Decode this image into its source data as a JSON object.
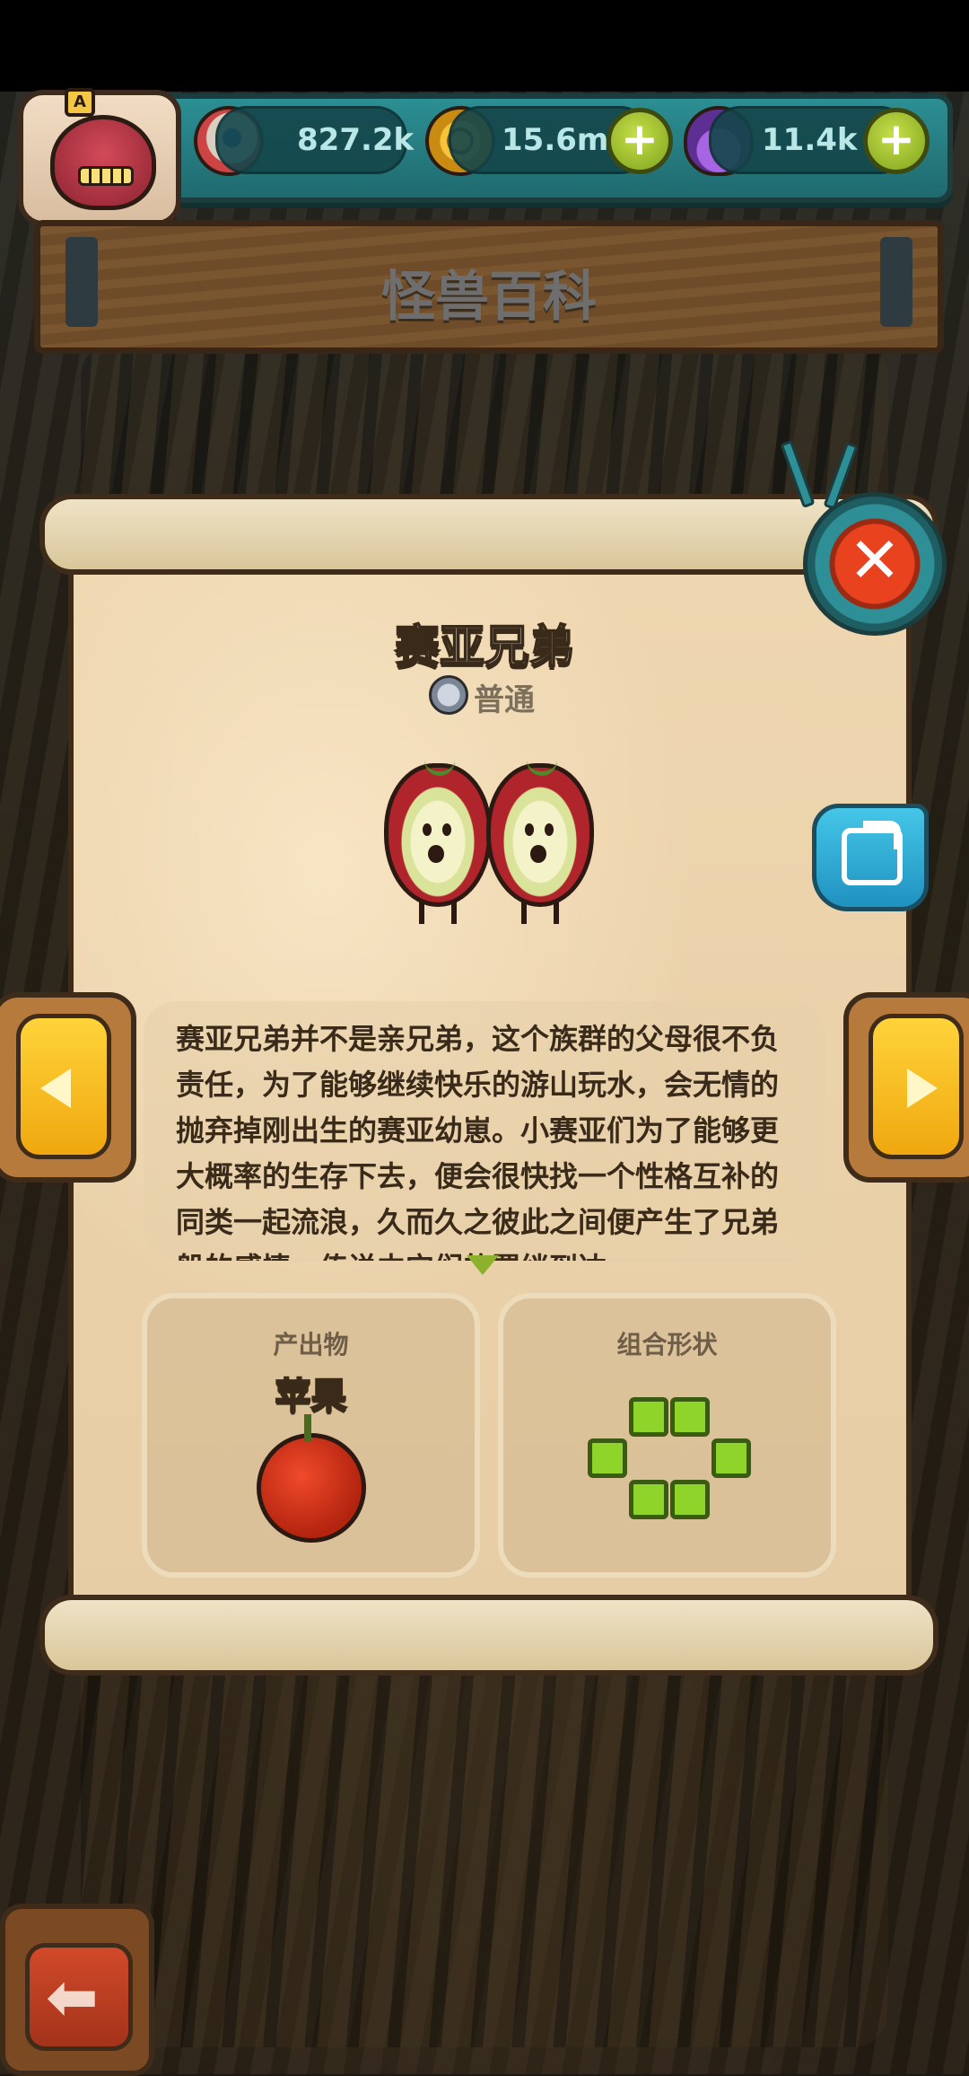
{
  "header": {
    "title": "怪兽百科",
    "avatar_letter": "A"
  },
  "resources": {
    "eyes": "827.2k",
    "coins": "15.6m",
    "potions": "11.4k",
    "plus_label": "+"
  },
  "monster": {
    "name": "赛亚兄弟",
    "rarity": "普通",
    "description": "赛亚兄弟并不是亲兄弟，这个族群的父母很不负责任，为了能够继续快乐的游山玩水，会无情的抛弃掉刚出生的赛亚幼崽。小赛亚们为了能够更大概率的生存下去，便会很快找一个性格互补的同类一起流浪，久而久之彼此之间便产生了兄弟般的感情。传说中它们的羁绊到达"
  },
  "product": {
    "label": "产出物",
    "name": "苹果"
  },
  "shape": {
    "label": "组合形状"
  },
  "icons": {
    "close": "close-icon",
    "share": "share-icon",
    "prev": "chevron-left-icon",
    "next": "chevron-right-icon",
    "back": "arrow-left-icon",
    "close_glyph": "✕",
    "back_glyph": "⬅"
  },
  "colors": {
    "accent_green": "#8ed42a",
    "close_red": "#e8421f",
    "share_blue": "#45c6e8",
    "arrow_yellow": "#ffd33a"
  }
}
